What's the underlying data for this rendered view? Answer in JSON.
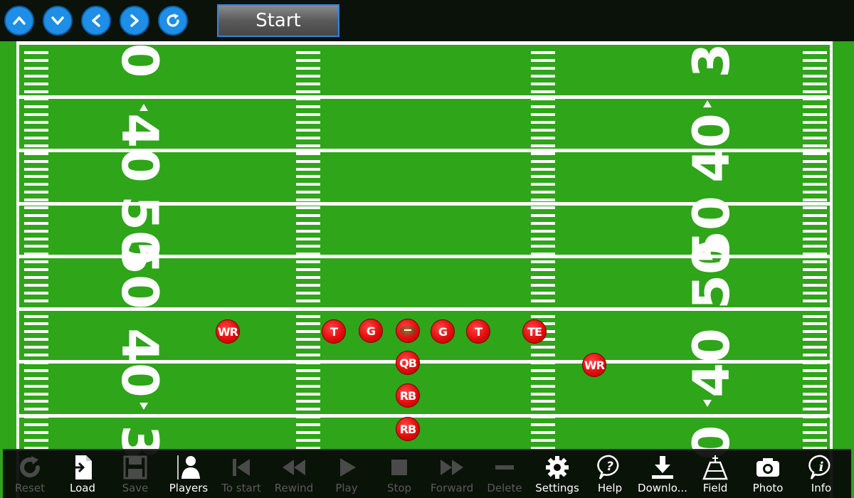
{
  "top_bar": {
    "start_label": "Start"
  },
  "field": {
    "left_numbers": [
      "0",
      "40",
      "50",
      "50",
      "40",
      "3"
    ],
    "right_numbers": [
      "3",
      "40",
      "50",
      "50",
      "40",
      "0"
    ]
  },
  "players": [
    {
      "label": "WR"
    },
    {
      "label": "T"
    },
    {
      "label": "G"
    },
    {
      "label": ""
    },
    {
      "label": "G"
    },
    {
      "label": "T"
    },
    {
      "label": "TE"
    },
    {
      "label": "WR"
    },
    {
      "label": "QB"
    },
    {
      "label": "RB"
    },
    {
      "label": "RB"
    }
  ],
  "toolbar": {
    "reset": "Reset",
    "load": "Load",
    "save": "Save",
    "players": "Players",
    "to_start": "To start",
    "rewind": "Rewind",
    "play": "Play",
    "stop": "Stop",
    "forward": "Forward",
    "delete": "Delete",
    "settings": "Settings",
    "help": "Help",
    "download": "Downlo...",
    "field": "Field",
    "photo": "Photo",
    "info": "Info"
  },
  "colors": {
    "field_green": "#2fa51a",
    "player_red": "#e30c0c",
    "nav_blue": "#1e8ee6",
    "disabled_gray": "#5a5a5a"
  }
}
